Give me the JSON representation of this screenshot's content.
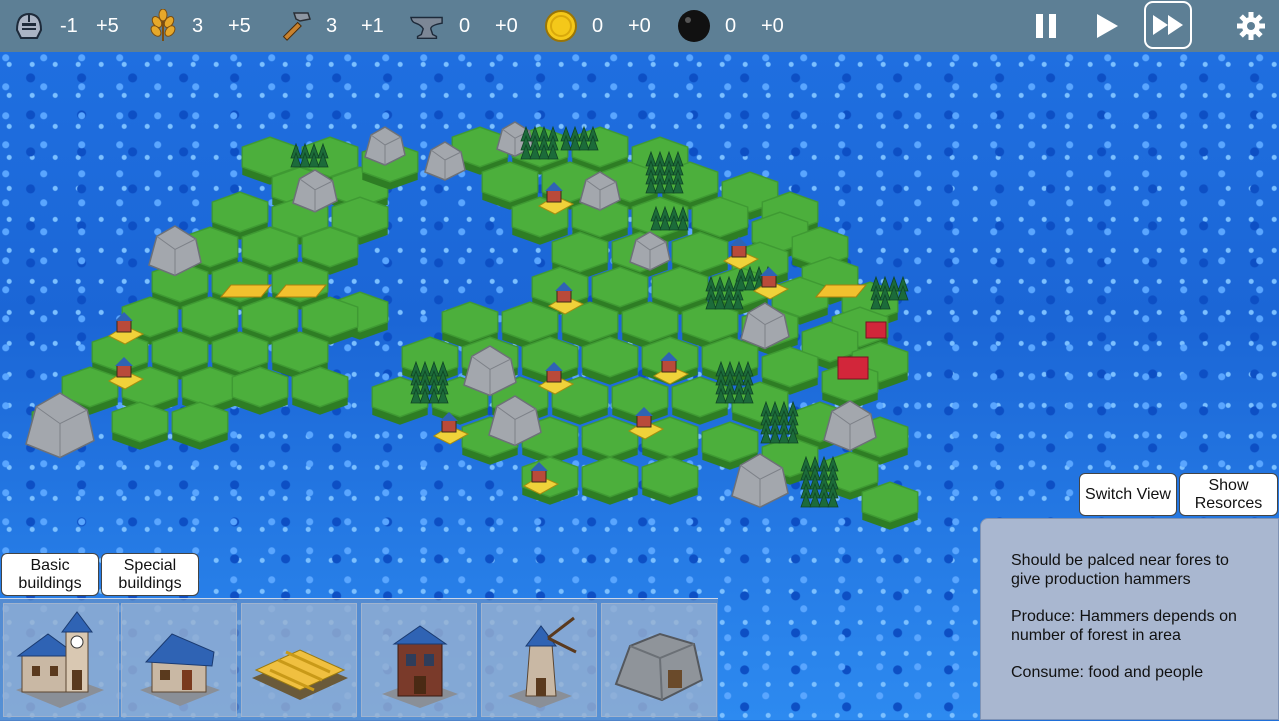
{
  "resources": [
    {
      "icon": "knight-helmet-icon",
      "amount": "-1",
      "delta": "+5"
    },
    {
      "icon": "wheat-icon",
      "amount": "3",
      "delta": "+5"
    },
    {
      "icon": "hammer-icon",
      "amount": "3",
      "delta": "+1"
    },
    {
      "icon": "anvil-icon",
      "amount": "0",
      "delta": "+0"
    },
    {
      "icon": "gold-coin-icon",
      "amount": "0",
      "delta": "+0"
    },
    {
      "icon": "black-ball-icon",
      "amount": "0",
      "delta": "+0"
    }
  ],
  "controls": {
    "pause": "pause-icon",
    "play": "play-icon",
    "fast_forward": "fast-forward-icon",
    "settings": "gear-icon"
  },
  "buttons": {
    "switch_view": "Switch View",
    "show_resources": "Show Resorces",
    "basic_buildings": "Basic buildings",
    "special_buildings": "Special buildings"
  },
  "building_slots": [
    {
      "name": "town-hall"
    },
    {
      "name": "house"
    },
    {
      "name": "farm-field"
    },
    {
      "name": "workshop"
    },
    {
      "name": "windmill"
    },
    {
      "name": "quarry"
    }
  ],
  "info_panel": {
    "description": "Should be palced near fores to give production hammers",
    "produce": "Produce: Hammers depends on number of forest in area",
    "consume": "Consume: food and people"
  },
  "colors": {
    "topbar": "#5d7f95",
    "water": "#1f6fd8",
    "grass": "#4caf3c",
    "info_panel": "#a9b7d0"
  }
}
